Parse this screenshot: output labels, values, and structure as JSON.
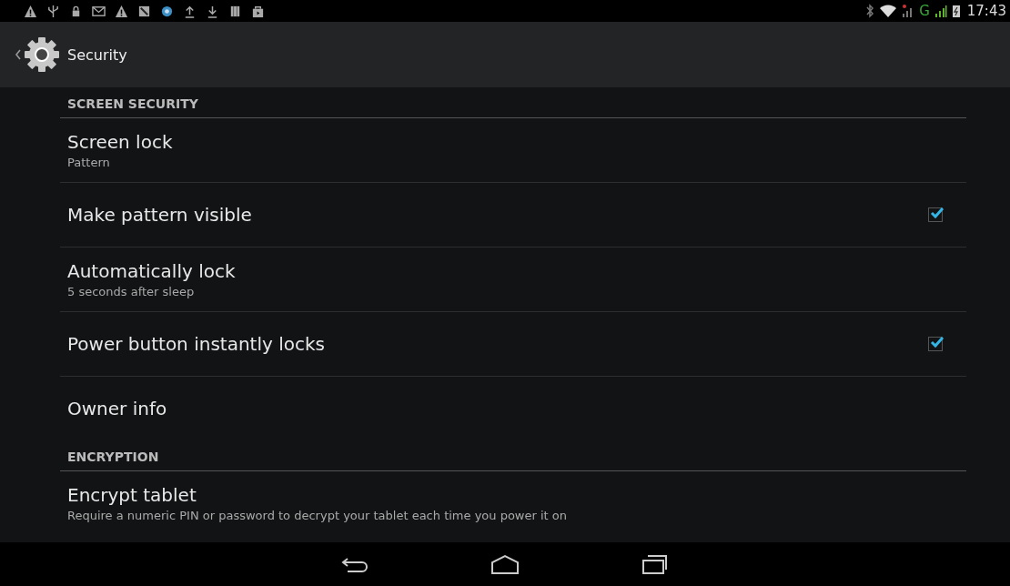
{
  "status_bar": {
    "network_type": "G",
    "time": "17:43"
  },
  "action_bar": {
    "title": "Security"
  },
  "sections": [
    {
      "header": "SCREEN SECURITY",
      "items": [
        {
          "kind": "text",
          "title": "Screen lock",
          "summary": "Pattern"
        },
        {
          "kind": "checkbox",
          "title": "Make pattern visible",
          "checked": true
        },
        {
          "kind": "text",
          "title": "Automatically lock",
          "summary": "5 seconds after sleep"
        },
        {
          "kind": "checkbox",
          "title": "Power button instantly locks",
          "checked": true
        },
        {
          "kind": "text",
          "title": "Owner info"
        }
      ]
    },
    {
      "header": "ENCRYPTION",
      "items": [
        {
          "kind": "text",
          "title": "Encrypt tablet",
          "summary": "Require a numeric PIN or password to decrypt your tablet each time you power it on"
        }
      ]
    }
  ]
}
